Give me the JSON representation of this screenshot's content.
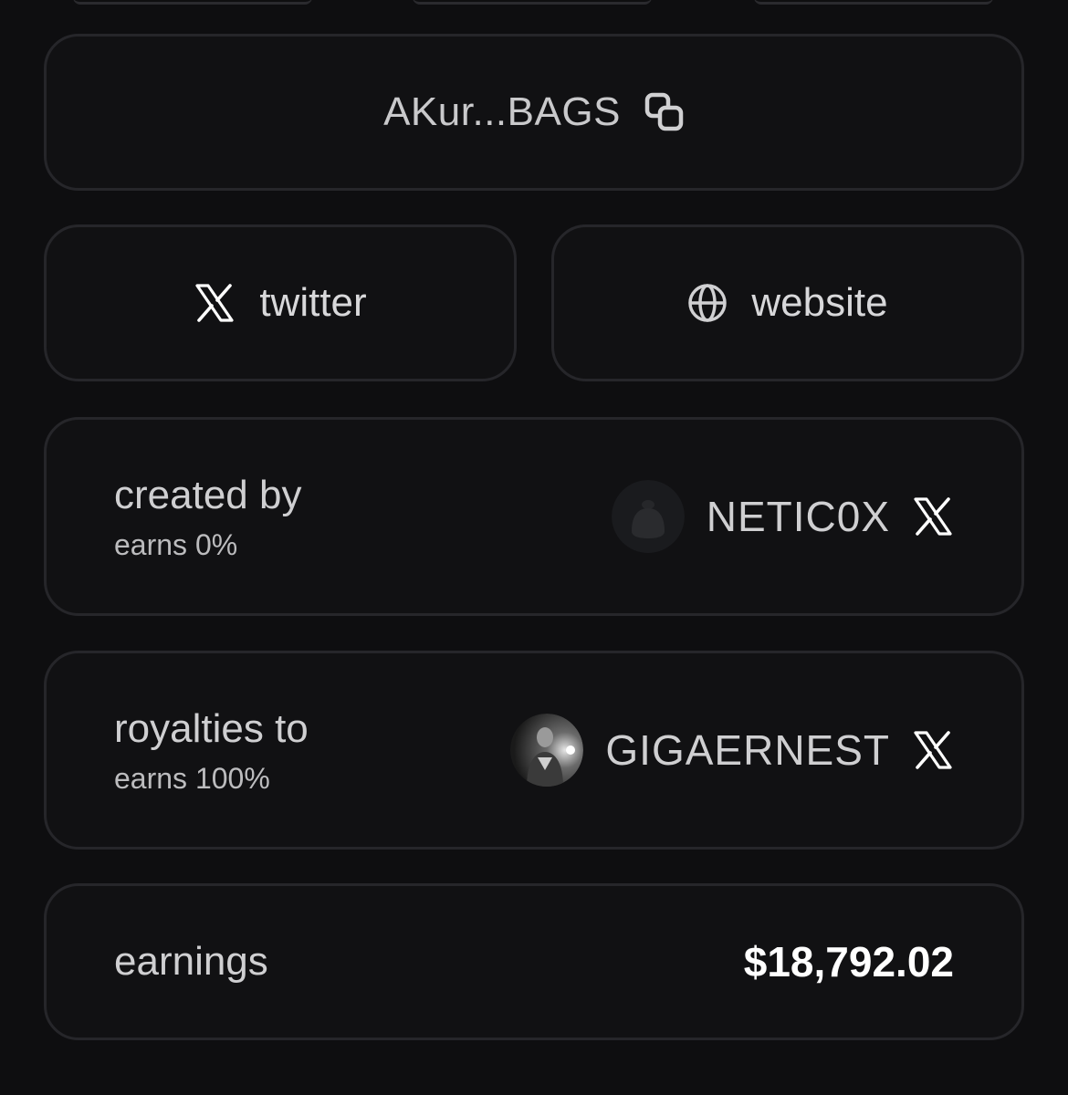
{
  "address": {
    "short": "AKur...BAGS",
    "copy_icon": "copy-icon"
  },
  "links": {
    "twitter": {
      "label": "twitter",
      "icon": "x-logo-icon"
    },
    "website": {
      "label": "website",
      "icon": "globe-icon"
    }
  },
  "creator": {
    "title": "created by",
    "earns": "earns 0%",
    "username": "NETIC0X",
    "avatar": "creator-avatar",
    "social_icon": "x-logo-icon"
  },
  "royalties": {
    "title": "royalties to",
    "earns": "earns 100%",
    "username": "GIGAERNEST",
    "avatar": "royalty-avatar",
    "social_icon": "x-logo-icon"
  },
  "earnings": {
    "label": "earnings",
    "value": "$18,792.02"
  },
  "colors": {
    "background": "#0e0e10",
    "card": "#111113",
    "border": "#26262a",
    "text": "#cfcfd1",
    "value": "#ffffff"
  }
}
